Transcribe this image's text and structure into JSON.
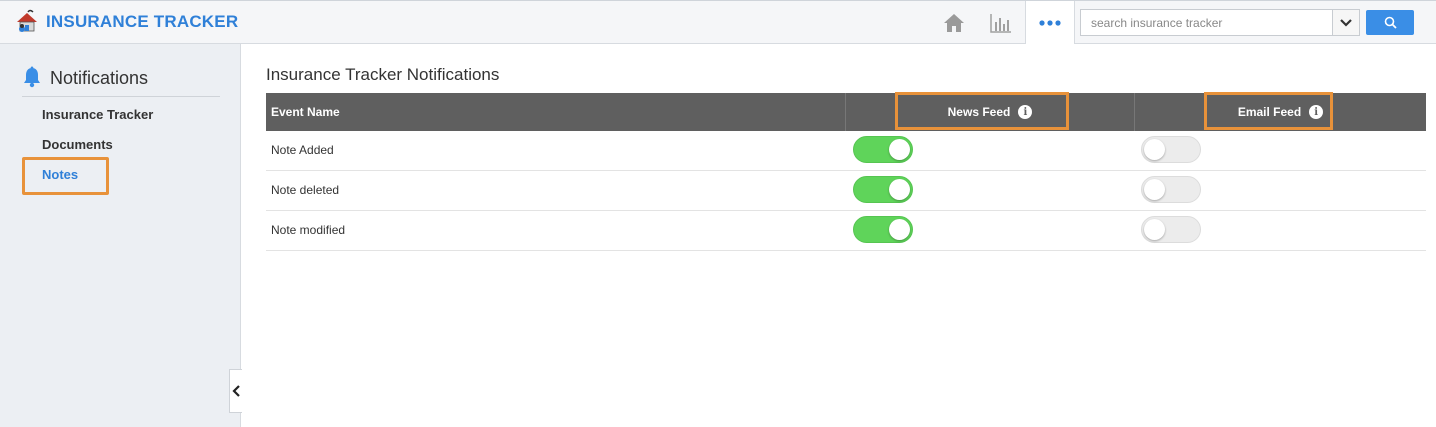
{
  "app": {
    "title": "INSURANCE TRACKER"
  },
  "search": {
    "placeholder": "search insurance tracker"
  },
  "icons": {
    "home": "home-icon",
    "chart": "bar-chart-icon",
    "more": "more-dots-icon",
    "dropdown": "chevron-down-icon",
    "search": "search-icon",
    "bell": "bell-icon",
    "collapse": "chevron-left-icon",
    "info": "info-icon"
  },
  "sidebar": {
    "title": "Notifications",
    "items": [
      {
        "label": "Insurance Tracker",
        "active": false
      },
      {
        "label": "Documents",
        "active": false
      },
      {
        "label": "Notes",
        "active": true
      }
    ]
  },
  "main": {
    "title": "Insurance Tracker Notifications",
    "table": {
      "headers": {
        "event": "Event Name",
        "news": "News Feed",
        "email": "Email Feed"
      },
      "rows": [
        {
          "name": "Note Added",
          "news_feed": true,
          "email_feed": false
        },
        {
          "name": "Note deleted",
          "news_feed": true,
          "email_feed": false
        },
        {
          "name": "Note modified",
          "news_feed": true,
          "email_feed": false
        }
      ]
    }
  },
  "colors": {
    "brand": "#2f80d8",
    "toggle_on": "#5fd45a",
    "highlight": "#e8923a",
    "header_bg": "#5f5f5f",
    "search_btn": "#3a8ee6"
  }
}
